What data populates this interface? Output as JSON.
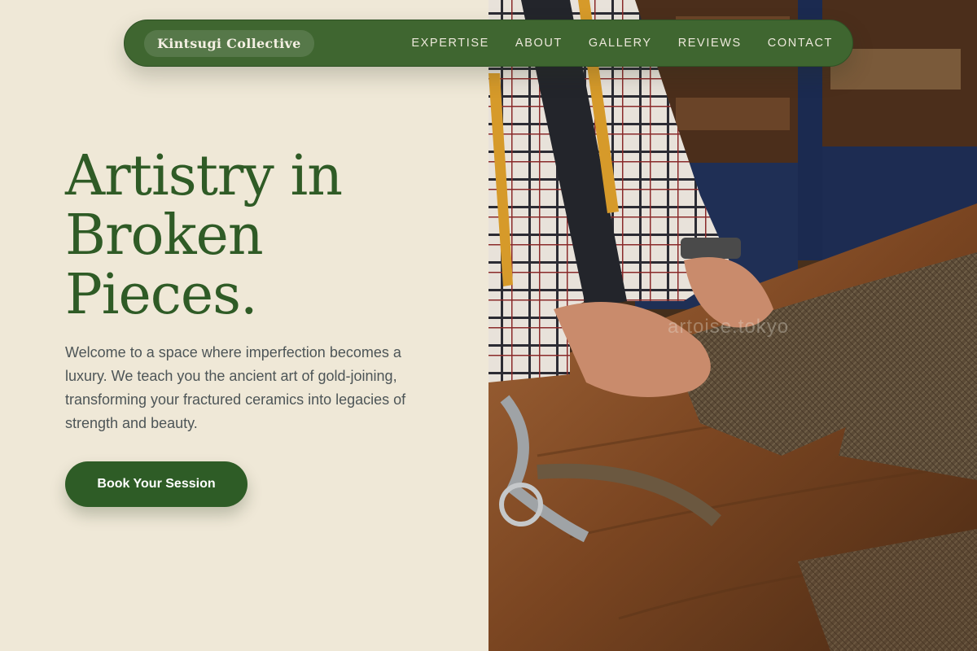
{
  "nav": {
    "brand": "Kintsugi Collective",
    "links": [
      "EXPERTISE",
      "ABOUT",
      "GALLERY",
      "REVIEWS",
      "CONTACT"
    ]
  },
  "hero": {
    "headline": "Artistry in Broken Pieces.",
    "intro": "Welcome to a space where imperfection becomes a luxury. We teach you the ancient art of gold-joining, transforming your fractured ceramics into legacies of strength and beauty.",
    "cta_label": "Book Your Session",
    "image_watermark": "artoise.tokyo"
  },
  "colors": {
    "background": "#efe8d7",
    "brand_green": "#3f6630",
    "headline_green": "#2f5b26",
    "cta_green": "#2e5c26",
    "body_text": "#4d5557"
  }
}
